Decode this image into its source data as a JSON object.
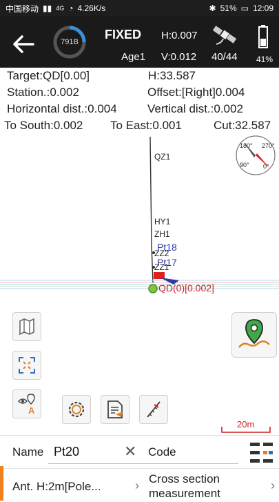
{
  "status_bar": {
    "carrier": "中国移动",
    "network": "4G",
    "speed": "4.26K/s",
    "battery": "51%",
    "time": "12:09"
  },
  "header": {
    "ring_value": "791B",
    "solution": "FIXED",
    "age": "Age1",
    "h_precision": "H:0.007",
    "v_precision": "V:0.012",
    "satellites": "40/44",
    "battery": "41%"
  },
  "info": {
    "target": "Target:QD[0.00]",
    "height": "H:33.587",
    "station": "Station.:0.002",
    "offset": "Offset:[Right]0.004",
    "hdist": "Horizontal dist.:0.004",
    "vdist": "Vertical dist.:0.002",
    "south": "To South:0.002",
    "east": "To East:0.001",
    "cut": "Cut:32.587"
  },
  "map": {
    "labels": {
      "qz1": "QZ1",
      "hy1": "HY1",
      "zh1": "ZH1",
      "pt18": "Pt18",
      "zz2": "ZZ2",
      "pt17": "Pt17",
      "zz1": "ZZ1",
      "qd": "QD(0)[0.002]"
    },
    "compass": {
      "n180": "180°",
      "n270": "270°",
      "n90": "90°",
      "n0": "0°"
    },
    "scale": "20m"
  },
  "bottom": {
    "name_label": "Name",
    "name_value": "Pt20",
    "code_label": "Code",
    "antenna": "Ant. H:2m[Pole...",
    "mode": "Cross section measurement"
  },
  "colors": {
    "header_bg": "#1a1a1a",
    "ring_accent": "#3a90d8",
    "accent_red": "#d02020",
    "point_blue": "#2b3aa8",
    "gps_green": "#2f9e44",
    "orange": "#f08020"
  }
}
